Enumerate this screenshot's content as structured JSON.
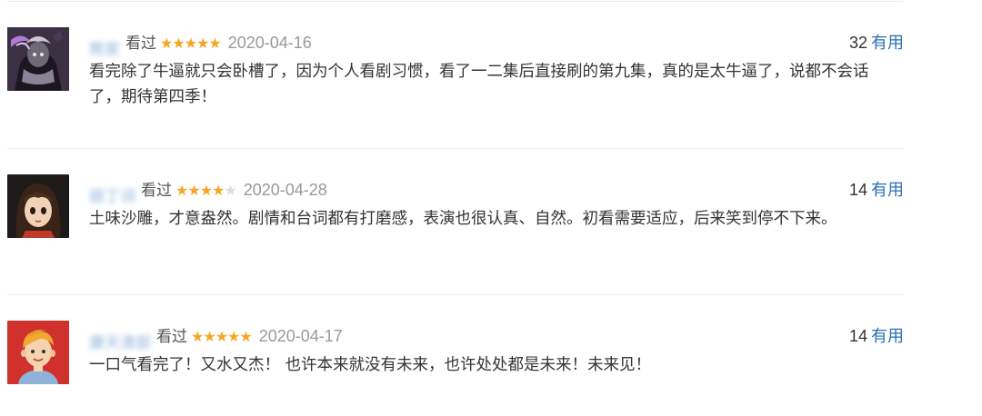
{
  "reviews": [
    {
      "username": "熊家",
      "watched_label": "看过",
      "rating": 5,
      "stars_text": "★★★★★",
      "stars_empty": "",
      "date": "2020-04-16",
      "useful_count": "32",
      "useful_label": "有用",
      "text": "看完除了牛逼就只会卧槽了，因为个人看剧习惯，看了一二集后直接刷的第九集，真的是太牛逼了，说都不会话了，期待第四季！",
      "avatar": "dark-character-avatar"
    },
    {
      "username": "丽丁词",
      "watched_label": "看过",
      "rating": 4,
      "stars_text": "★★★★",
      "stars_empty": "★",
      "date": "2020-04-28",
      "useful_count": "14",
      "useful_label": "有用",
      "text": "土味沙雕，才意盎然。剧情和台词都有打磨感，表演也很认真、自然。初看需要适应，后来笑到停不下来。",
      "avatar": "anime-girl-avatar"
    },
    {
      "username": "康天清部",
      "watched_label": "看过",
      "rating": 5,
      "stars_text": "★★★★★",
      "stars_empty": "",
      "date": "2020-04-17",
      "useful_count": "14",
      "useful_label": "有用",
      "text": "一口气看完了！又水又杰！ 也许本来就没有未来，也许处处都是未来！未来见！",
      "avatar": "cartoon-boy-avatar"
    }
  ],
  "colors": {
    "star": "#f5a623",
    "link": "#2b6fb4",
    "date": "#999999",
    "divider": "#eeeeee"
  }
}
